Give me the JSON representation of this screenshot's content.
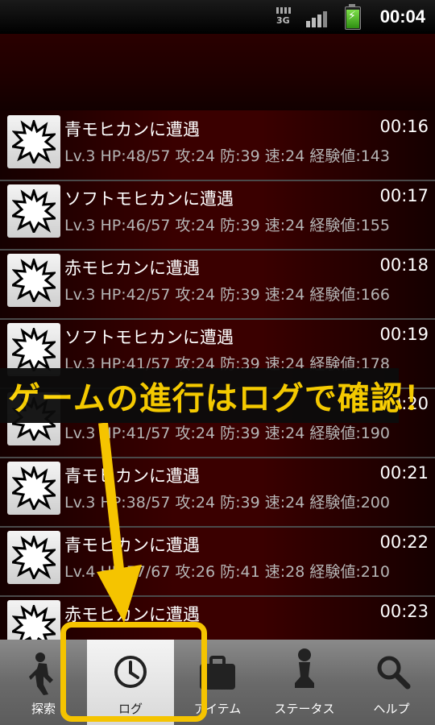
{
  "status_bar": {
    "network": "3G",
    "time": "00:04"
  },
  "log_entries": [
    {
      "title": "青モヒカンに遭遇",
      "time": "00:16",
      "stats": "Lv.3 HP:48/57 攻:24 防:39 速:24 経験値:143"
    },
    {
      "title": "ソフトモヒカンに遭遇",
      "time": "00:17",
      "stats": "Lv.3 HP:46/57 攻:24 防:39 速:24 経験値:155"
    },
    {
      "title": "赤モヒカンに遭遇",
      "time": "00:18",
      "stats": "Lv.3 HP:42/57 攻:24 防:39 速:24 経験値:166"
    },
    {
      "title": "ソフトモヒカンに遭遇",
      "time": "00:19",
      "stats": "Lv.3 HP:41/57 攻:24 防:39 速:24 経験値:178"
    },
    {
      "title": "",
      "time": "00:20",
      "stats": "Lv.3 HP:41/57 攻:24 防:39 速:24 経験値:190"
    },
    {
      "title": "青モヒカンに遭遇",
      "time": "00:21",
      "stats": "Lv.3 HP:38/57 攻:24 防:39 速:24 経験値:200"
    },
    {
      "title": "青モヒカンに遭遇",
      "time": "00:22",
      "stats": "Lv.4 HP:57/67 攻:26 防:41 速:28 経験値:210"
    },
    {
      "title": "赤モヒカンに遭遇",
      "time": "00:23",
      "stats": ""
    }
  ],
  "tabs": [
    {
      "label": "探索",
      "icon": "walker-icon",
      "selected": false
    },
    {
      "label": "ログ",
      "icon": "clock-icon",
      "selected": true
    },
    {
      "label": "アイテム",
      "icon": "bag-icon",
      "selected": false
    },
    {
      "label": "ステータス",
      "icon": "chess-pawn-icon",
      "selected": false
    },
    {
      "label": "ヘルプ",
      "icon": "search-icon",
      "selected": false
    }
  ],
  "annotation": {
    "caption": "ゲームの進行はログで確認！",
    "highlight_color": "#f5c400"
  }
}
